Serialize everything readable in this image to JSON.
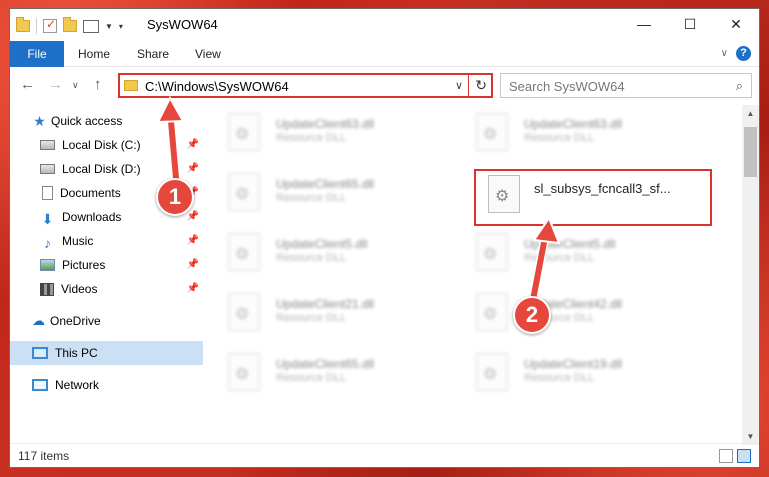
{
  "window": {
    "title": "SysWOW64"
  },
  "ribbon": {
    "tabs": [
      "File",
      "Home",
      "Share",
      "View"
    ]
  },
  "navbar": {
    "address": "C:\\Windows\\SysWOW64",
    "search_placeholder": "Search SysWOW64"
  },
  "sidebar": {
    "items": [
      {
        "label": "Quick access",
        "icon": "star-icon"
      },
      {
        "label": "Local Disk (C:)",
        "icon": "disk-icon"
      },
      {
        "label": "Local Disk (D:)",
        "icon": "disk-icon"
      },
      {
        "label": "Documents",
        "icon": "documents-icon"
      },
      {
        "label": "Downloads",
        "icon": "downloads-icon"
      },
      {
        "label": "Music",
        "icon": "music-icon"
      },
      {
        "label": "Pictures",
        "icon": "pictures-icon"
      },
      {
        "label": "Videos",
        "icon": "videos-icon"
      },
      {
        "label": "OneDrive",
        "icon": "cloud-icon"
      },
      {
        "label": "This PC",
        "icon": "computer-icon"
      },
      {
        "label": "Network",
        "icon": "network-icon"
      }
    ]
  },
  "files": [
    {
      "name": "UpdateClient63.dll",
      "type": "Resource DLL"
    },
    {
      "name": "UpdateClient63.dll",
      "type": "Resource DLL"
    },
    {
      "name": "UpdateClient65.dll",
      "type": "Resource DLL"
    },
    {
      "name": "sl_subsys_fcncall3_sf...",
      "type": ""
    },
    {
      "name": "UpdateClient5.dll",
      "type": "Resource DLL"
    },
    {
      "name": "UpdateClient5.dll",
      "type": "Resource DLL"
    },
    {
      "name": "UpdateClient21.dll",
      "type": "Resource DLL"
    },
    {
      "name": "UpdateClient42.dll",
      "type": "Resource DLL"
    },
    {
      "name": "UpdateClient65.dll",
      "type": "Resource DLL"
    },
    {
      "name": "UpdateClient19.dll",
      "type": "Resource DLL"
    }
  ],
  "status": {
    "item_count": "117 items"
  },
  "annotations": {
    "step1": "1",
    "step2": "2",
    "accent_color": "#d9332b"
  }
}
